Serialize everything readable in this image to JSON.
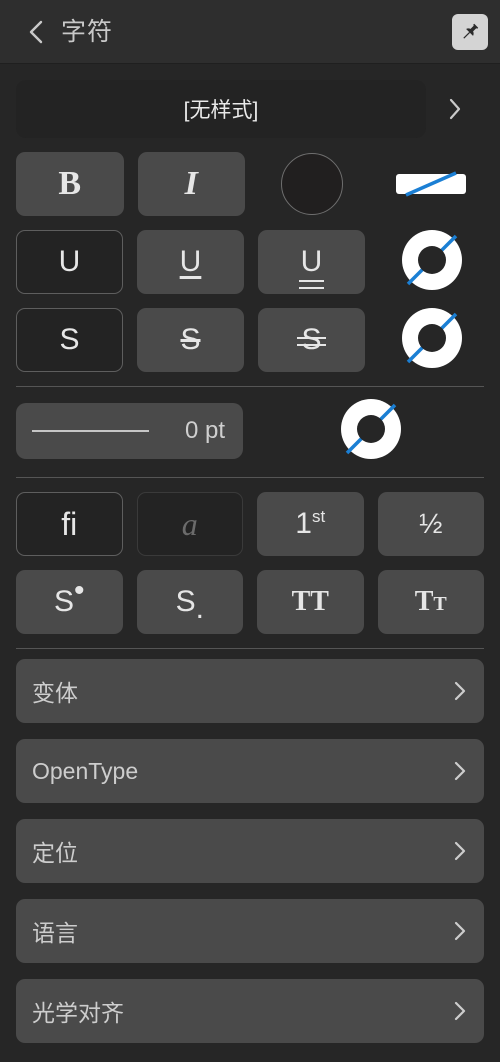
{
  "header": {
    "title": "字符",
    "back_icon": "chevron-left-icon",
    "pin_icon": "pushpin-icon"
  },
  "style": {
    "name": "[无样式]",
    "chevron_icon": "chevron-right-icon"
  },
  "format_buttons": {
    "bold": "B",
    "italic": "I",
    "fill_swatch_icon": "fill-color-circle",
    "stroke_swatch_icon": "stroke-color-bar"
  },
  "underline_row": {
    "none": "U",
    "single": "U",
    "double": "U",
    "color_swatch_icon": "underline-color-donut"
  },
  "strikethrough_row": {
    "none": "S",
    "single": "S",
    "double": "S",
    "color_swatch_icon": "strikethrough-color-donut"
  },
  "stroke_width": {
    "value": "0 pt",
    "color_swatch_icon": "stroke-color-donut"
  },
  "typography_row1": [
    {
      "label": "fi",
      "name": "ligatures-button",
      "state": "selected"
    },
    {
      "label": "a",
      "name": "swash-button",
      "state": "disabled"
    },
    {
      "label": "1",
      "sup": "st",
      "name": "ordinal-button",
      "state": "normal"
    },
    {
      "label": "½",
      "name": "fraction-button",
      "state": "normal"
    }
  ],
  "typography_row2": [
    {
      "label": "S",
      "mark": "•",
      "name": "superscript-button",
      "state": "normal"
    },
    {
      "label": "S",
      "mark": ".",
      "name": "subscript-button",
      "state": "normal"
    },
    {
      "label": "TT",
      "name": "all-caps-button",
      "state": "normal"
    },
    {
      "label": "T",
      "small": "T",
      "name": "small-caps-button",
      "state": "normal"
    }
  ],
  "list_items": [
    {
      "label": "变体",
      "name": "sidebar-item-variants"
    },
    {
      "label": "OpenType",
      "name": "sidebar-item-opentype"
    },
    {
      "label": "定位",
      "name": "sidebar-item-positioning"
    },
    {
      "label": "语言",
      "name": "sidebar-item-language"
    },
    {
      "label": "光学对齐",
      "name": "sidebar-item-optical-alignment"
    }
  ],
  "colors": {
    "background": "#262626",
    "header_background": "#2e2e2e",
    "button_background": "#4a4a4a",
    "selected_background": "#232323",
    "accent_blue": "#1b7fd4",
    "text": "#cdcdcd"
  }
}
